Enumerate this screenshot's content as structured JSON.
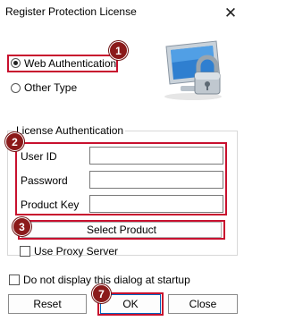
{
  "window": {
    "title": "Register Protection License"
  },
  "auth_type": {
    "options": [
      "Web Authentication",
      "Other Type"
    ],
    "selected": "Web Authentication"
  },
  "license_auth": {
    "group_label": "License Authentication",
    "user_id_label": "User ID",
    "user_id_value": "",
    "password_label": "Password",
    "password_value": "",
    "product_key_label": "Product Key",
    "product_key_value": "",
    "select_product_label": "Select Product",
    "use_proxy_label": "Use Proxy Server",
    "use_proxy_checked": false
  },
  "footer": {
    "no_display_label": "Do not display this dialog at startup",
    "no_display_checked": false,
    "reset_label": "Reset",
    "ok_label": "OK",
    "close_label": "Close"
  },
  "badges": {
    "b1": "1",
    "b2": "2",
    "b3": "3",
    "b7": "7"
  },
  "colors": {
    "annotation_red": "#c8102e",
    "badge_fill": "#8b1a1a"
  },
  "icons": {
    "close": "close-icon",
    "license_image": "monitor-padlock-icon"
  }
}
